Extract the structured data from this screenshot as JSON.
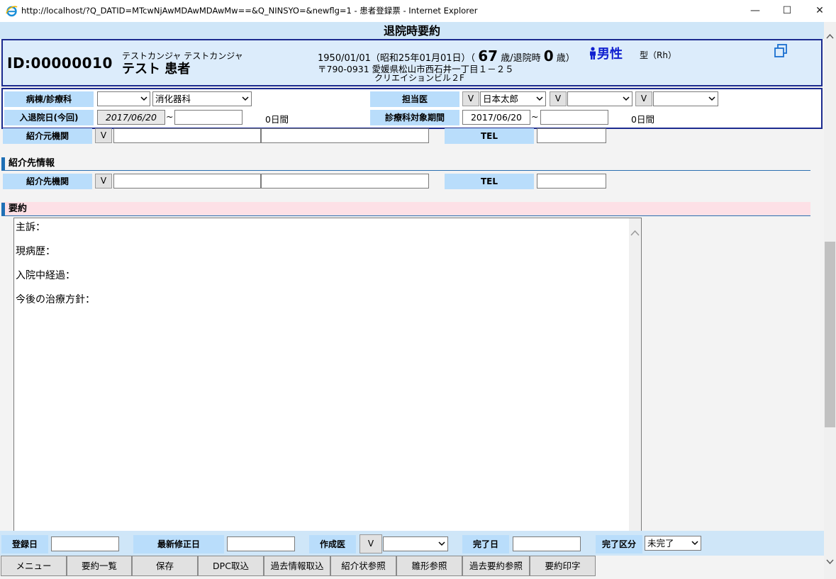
{
  "window": {
    "title": "http://localhost/?Q_DATID=MTcwNjAwMDAwMDAwMw==&Q_NINSYO=&newflg=1 - 患者登録票 - Internet Explorer",
    "minimize": "—",
    "maximize": "☐",
    "close": "✕"
  },
  "page": {
    "title": "退院時要約"
  },
  "patient": {
    "id": "ID:00000010",
    "kana": "テストカンジャ テストカンジャ",
    "name": "テスト 患者",
    "dob": "1950/01/01（昭和25年01月01日）（",
    "age": "67",
    "age_unit": "歳/退院時",
    "discharge_age": "0",
    "discharge_unit": "歳）",
    "gender": "男性",
    "blood": "型（Rh）",
    "address1": "〒790-0931 愛媛県松山市西石井一丁目１－２５",
    "address2": "クリエイションビル２F"
  },
  "info": {
    "ward_label": "病棟/診療科",
    "ward_value": "",
    "dept_value": "消化器科",
    "doctor_label": "担当医",
    "doctor1": "日本太郎",
    "doctor2": "",
    "doctor3": "",
    "admission_label": "入退院日(今回)",
    "admission_from": "2017/06/20",
    "tilde": "~",
    "admission_to": "",
    "admission_days": "0日間",
    "period_label": "診療科対象期間",
    "period_from": "2017/06/20",
    "period_to": "",
    "period_days": "0日間",
    "v": "V"
  },
  "referral_from": {
    "label": "紹介元機関",
    "v": "V",
    "name1": "",
    "name2": "",
    "tel_label": "TEL",
    "tel": ""
  },
  "referral_to": {
    "section": "紹介先情報",
    "label": "紹介先機関",
    "v": "V",
    "name1": "",
    "name2": "",
    "tel_label": "TEL",
    "tel": ""
  },
  "summary": {
    "section": "要約",
    "lines": [
      "主訴：",
      "現病歴：",
      "入院中経過：",
      "今後の治療方針："
    ]
  },
  "footer": {
    "reg_label": "登録日",
    "reg_value": "",
    "mod_label": "最新修正日",
    "mod_value": "",
    "author_label": "作成医",
    "author_v": "V",
    "author_value": "",
    "done_label": "完了日",
    "done_value": "",
    "status_label": "完了区分",
    "status_value": "未完了"
  },
  "buttons": [
    "メニュー",
    "要約一覧",
    "保存",
    "DPC取込",
    "過去情報取込",
    "紹介状参照",
    "雛形参照",
    "過去要約参照",
    "要約印字"
  ],
  "colors": {
    "label_bg": "#b9ddfb",
    "header_bg": "#cfe6f8",
    "border": "#1c2b8f",
    "gender": "#1020d0",
    "summary_head": "#fde0e6"
  }
}
